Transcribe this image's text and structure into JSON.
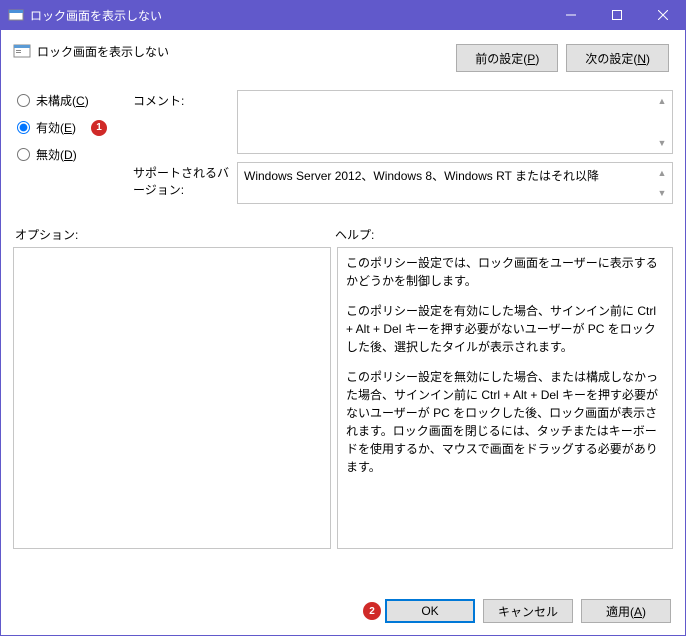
{
  "window": {
    "title": "ロック画面を表示しない"
  },
  "header": {
    "title": "ロック画面を表示しない"
  },
  "nav": {
    "prev": "前の設定",
    "prev_key": "P",
    "next": "次の設定",
    "next_key": "N"
  },
  "radios": {
    "not_configured": "未構成",
    "not_configured_key": "C",
    "enabled": "有効",
    "enabled_key": "E",
    "disabled": "無効",
    "disabled_key": "D",
    "selected": "enabled"
  },
  "fields": {
    "comment_label": "コメント:",
    "comment_value": "",
    "version_label": "サポートされるバージョン:",
    "version_value": "Windows Server 2012、Windows 8、Windows RT またはそれ以降"
  },
  "sections": {
    "options_label": "オプション:",
    "help_label": "ヘルプ:"
  },
  "help_text": {
    "p1": "このポリシー設定では、ロック画面をユーザーに表示するかどうかを制御します。",
    "p2": "このポリシー設定を有効にした場合、サインイン前に Ctrl + Alt + Del キーを押す必要がないユーザーが PC をロックした後、選択したタイルが表示されます。",
    "p3": "このポリシー設定を無効にした場合、または構成しなかった場合、サインイン前に Ctrl + Alt + Del キーを押す必要がないユーザーが PC をロックした後、ロック画面が表示されます。ロック画面を閉じるには、タッチまたはキーボードを使用するか、マウスで画面をドラッグする必要があります。"
  },
  "buttons": {
    "ok": "OK",
    "cancel": "キャンセル",
    "apply": "適用",
    "apply_key": "A"
  },
  "annotations": {
    "badge1": "1",
    "badge2": "2"
  }
}
